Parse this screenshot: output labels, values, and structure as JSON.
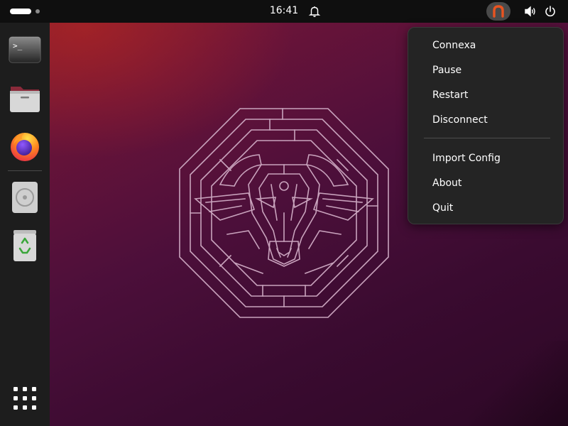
{
  "topbar": {
    "clock": "16:41",
    "icons": [
      "notification-bell-icon",
      "connexa-tray-icon",
      "volume-icon",
      "power-icon"
    ]
  },
  "dock": {
    "items": [
      {
        "name": "terminal",
        "icon": "terminal-icon",
        "glyph": ">_"
      },
      {
        "name": "files",
        "icon": "folder-icon"
      },
      {
        "name": "firefox",
        "icon": "firefox-icon"
      },
      {
        "name": "disc",
        "icon": "disc-icon"
      },
      {
        "name": "trash",
        "icon": "trash-icon"
      }
    ],
    "apps_icon": "app-grid-icon"
  },
  "menu": {
    "items": [
      {
        "id": "connexa",
        "label": "Connexa"
      },
      {
        "id": "pause",
        "label": "Pause"
      },
      {
        "id": "restart",
        "label": "Restart"
      },
      {
        "id": "disconnect",
        "label": "Disconnect"
      },
      {
        "id": "import-config",
        "label": "Import Config"
      },
      {
        "id": "about",
        "label": "About"
      },
      {
        "id": "quit",
        "label": "Quit"
      }
    ]
  },
  "colors": {
    "topbar": "#0f0f0f",
    "dock": "#1d1d1d",
    "menu_bg": "#242424",
    "accent_orange": "#e95420",
    "wallpaper_dark": "#2d0826"
  }
}
